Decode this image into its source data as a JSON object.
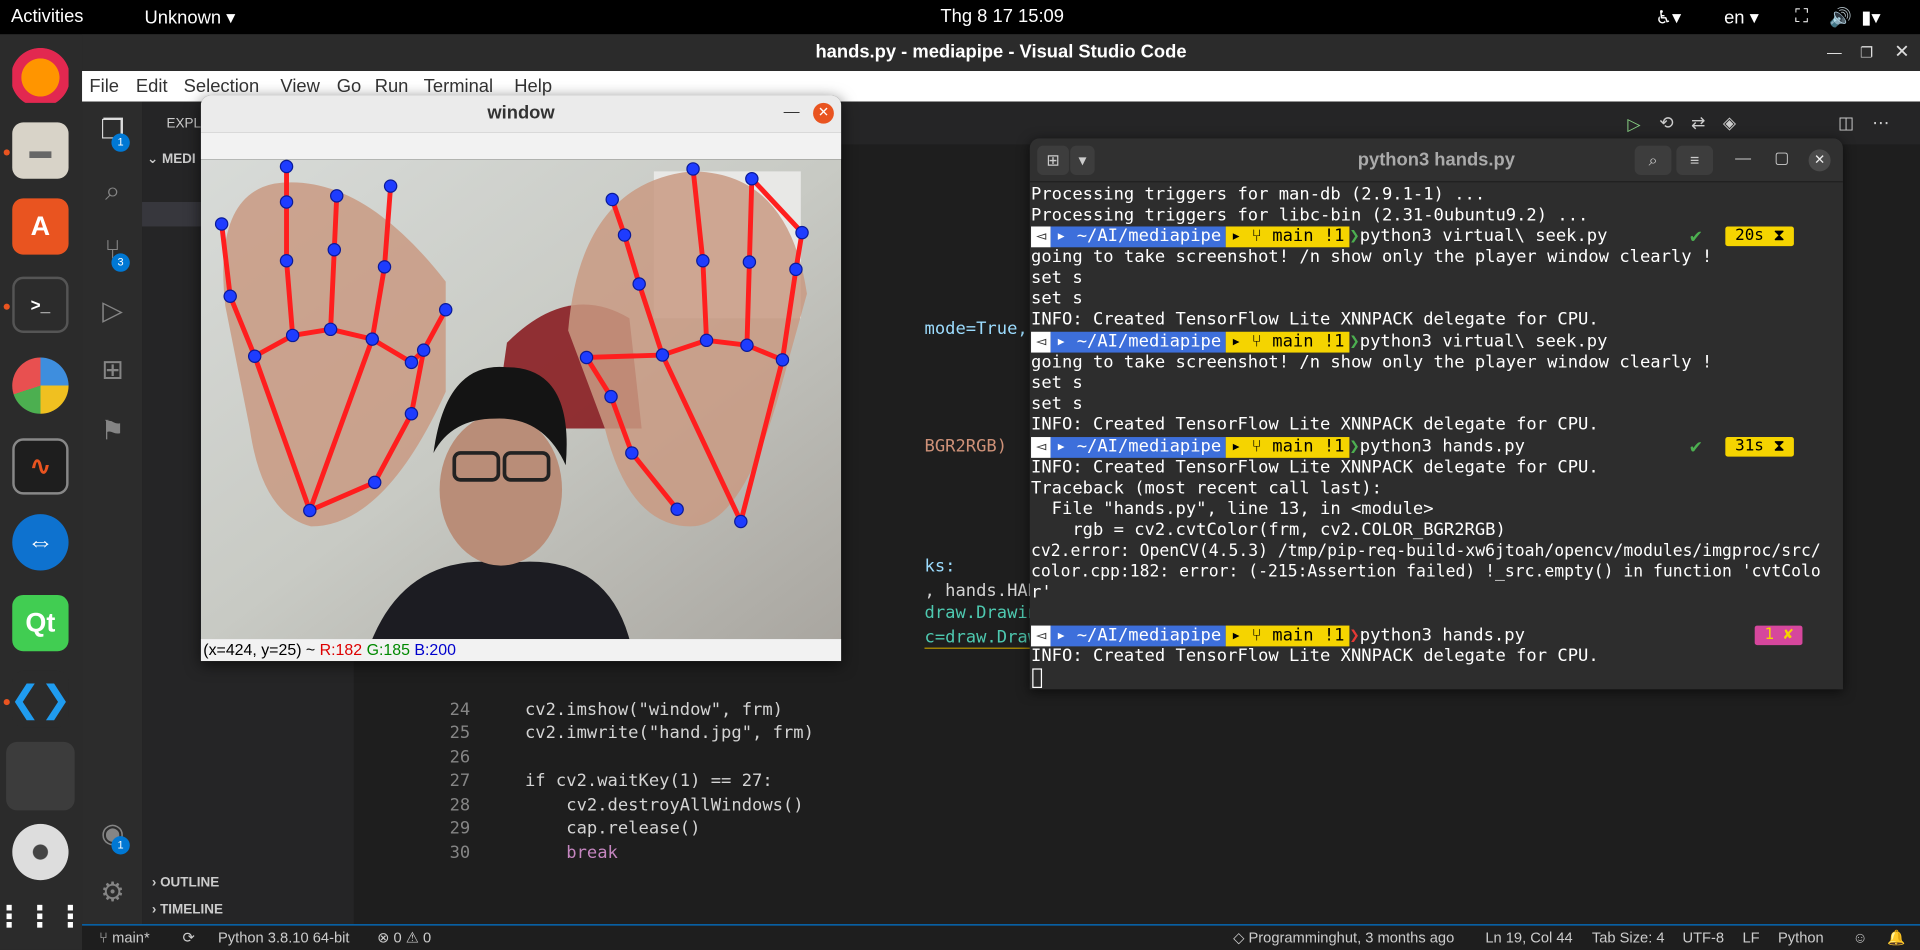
{
  "topbar": {
    "activities": "Activities",
    "app_menu": "Unknown",
    "clock": "Thg 8 17  15:09",
    "lang": "en"
  },
  "vscode": {
    "title": "hands.py - mediapipe - Visual Studio Code",
    "menu": [
      "File",
      "Edit",
      "Selection",
      "View",
      "Go",
      "Run",
      "Terminal",
      "Help"
    ],
    "sidebar_header": "EXPLO",
    "sidebar_folder": "MEDI",
    "outline": "OUTLINE",
    "timeline": "TIMELINE",
    "badges": {
      "explorer": "1",
      "scm": "3",
      "accounts": "1"
    }
  },
  "code": {
    "partial_lines": [
      {
        "text": "mode=True, min_det"
      },
      {
        "text": "BGR2RGB)"
      },
      {
        "text": "ks:"
      },
      {
        "text": ", hands.HAND_CONNE"
      },
      {
        "text": "draw.DrawingSpec(c"
      },
      {
        "text": "c=draw.DrawingSpec"
      }
    ],
    "lines": [
      {
        "num": "24",
        "text": "    cv2.imshow(\"window\", frm)"
      },
      {
        "num": "25",
        "text": "    cv2.imwrite(\"hand.jpg\", frm)"
      },
      {
        "num": "26",
        "text": ""
      },
      {
        "num": "27",
        "text": "    if cv2.waitKey(1) == 27:"
      },
      {
        "num": "28",
        "text": "        cv2.destroyAllWindows()"
      },
      {
        "num": "29",
        "text": "        cap.release()"
      },
      {
        "num": "30",
        "text": "        break"
      }
    ]
  },
  "statusbar": {
    "branch": "main*",
    "python": "Python 3.8.10 64-bit",
    "problems": "⊗ 0 ⚠ 0",
    "blame": "Programminghut, 3 months ago",
    "position": "Ln 19, Col 44",
    "tab_size": "Tab Size: 4",
    "encoding": "UTF-8",
    "eol": "LF",
    "language": "Python"
  },
  "terminal": {
    "title": "python3 hands.py",
    "path": "~/AI/mediapipe",
    "branch": "main !1",
    "lines": [
      "Processing triggers for man-db (2.9.1-1) ...",
      "Processing triggers for libc-bin (2.31-0ubuntu9.2) ...",
      "going to take screenshot! /n show only the player window clearly !",
      "set s",
      "set s",
      "INFO: Created TensorFlow Lite XNNPACK delegate for CPU.",
      "going to take screenshot! /n show only the player window clearly !",
      "set s",
      "set s",
      "INFO: Created TensorFlow Lite XNNPACK delegate for CPU.",
      "INFO: Created TensorFlow Lite XNNPACK delegate for CPU.",
      "Traceback (most recent call last):",
      "  File \"hands.py\", line 13, in <module>",
      "    rgb = cv2.cvtColor(frm, cv2.COLOR_BGR2RGB)",
      "cv2.error: OpenCV(4.5.3) /tmp/pip-req-build-xw6jtoah/opencv/modules/imgproc/src/",
      "color.cpp:182: error: (-215:Assertion failed) !_src.empty() in function 'cvtColo",
      "r'",
      "INFO: Created TensorFlow Lite XNNPACK delegate for CPU."
    ],
    "cmds": [
      "python3 virtual\\ seek.py",
      "python3 virtual\\ seek.py",
      "python3 hands.py",
      "python3 hands.py"
    ],
    "durations": [
      "20s ⧗",
      "31s ⧗",
      "1 ✘"
    ]
  },
  "cvwindow": {
    "title": "window",
    "status_coords": "(x=424, y=25) ~ ",
    "r": "R:182",
    "g": "G:185",
    "b": "B:200"
  }
}
